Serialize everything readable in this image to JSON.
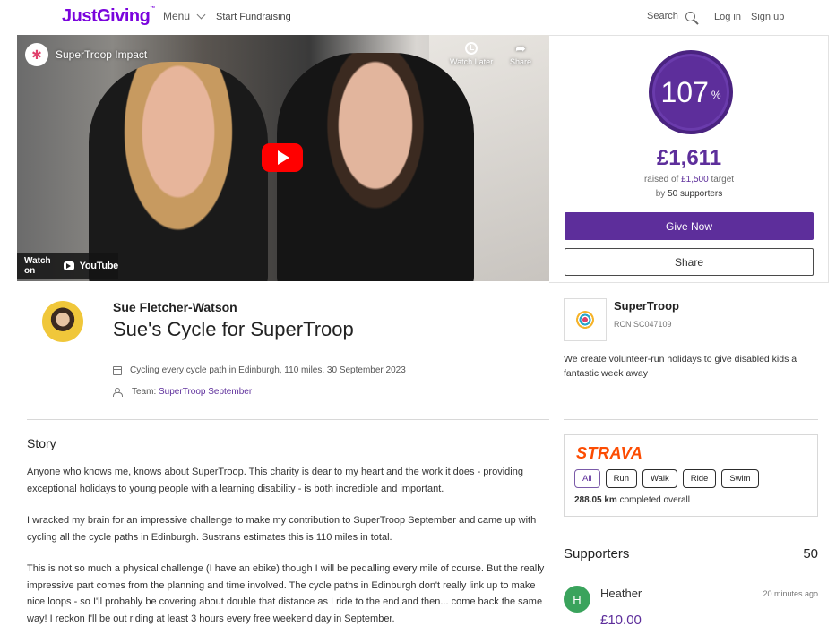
{
  "header": {
    "logo": "JustGiving",
    "logo_tm": "™",
    "menu_label": "Menu",
    "start_fundraising": "Start Fundraising",
    "search_label": "Search",
    "login": "Log in",
    "signup": "Sign up",
    "brand_color": "#7a04dd"
  },
  "video": {
    "channel_title": "SuperTroop Impact",
    "watch_later": "Watch Later",
    "share": "Share",
    "watch_on": "Watch on",
    "youtube": "YouTube"
  },
  "donation": {
    "percent": "107",
    "percent_sign": "%",
    "percent_value": 107,
    "amount_raised": "£1,611",
    "raised_of_prefix": "raised of",
    "target": "£1,500",
    "target_suffix": "target",
    "by_prefix": "by",
    "supporters": "50 supporters",
    "give_now": "Give Now",
    "share": "Share",
    "accent_color": "#5d2e9b"
  },
  "fundraiser": {
    "name": "Sue Fletcher-Watson",
    "title": "Sue's Cycle for SuperTroop",
    "activity": "Cycling every cycle path in Edinburgh, 110 miles, 30 September 2023",
    "team_prefix": "Team:",
    "team_name": "SuperTroop September"
  },
  "story": {
    "heading": "Story",
    "paragraphs": [
      "Anyone who knows me, knows about SuperTroop. This charity is dear to my heart and the work it does - providing exceptional holidays to young people with a learning disability - is both incredible and important.",
      "I wracked my brain for an impressive challenge to make my contribution to SuperTroop September and came up with cycling all the cycle paths in Edinburgh. Sustrans estimates this is 110 miles in total.",
      "This is not so much a physical challenge (I have an ebike) though I will be pedalling every mile of course. But the really impressive part comes from the planning and time involved. The cycle paths in Edinburgh don't really link up to make nice loops - so I'll probably be covering about double that distance as I ride to the end and then... come back the same way! I reckon I'll be out riding at least 3 hours every free weekend day in September."
    ]
  },
  "charity": {
    "name": "SuperTroop",
    "rcn": "RCN SC047109",
    "description": "We create volunteer-run holidays to give disabled kids a fantastic week away"
  },
  "strava": {
    "logo": "STRAVA",
    "tabs": [
      "All",
      "Run",
      "Walk",
      "Ride",
      "Swim"
    ],
    "active_tab": "All",
    "distance": "288.05 km",
    "distance_suffix": "completed overall",
    "brand_color": "#fc4c02"
  },
  "supporters": {
    "title": "Supporters",
    "count": "50",
    "items": [
      {
        "initial": "H",
        "name": "Heather",
        "time": "20 minutes ago",
        "amount": "£10.00",
        "avatar_color": "#3aa35c"
      }
    ]
  }
}
